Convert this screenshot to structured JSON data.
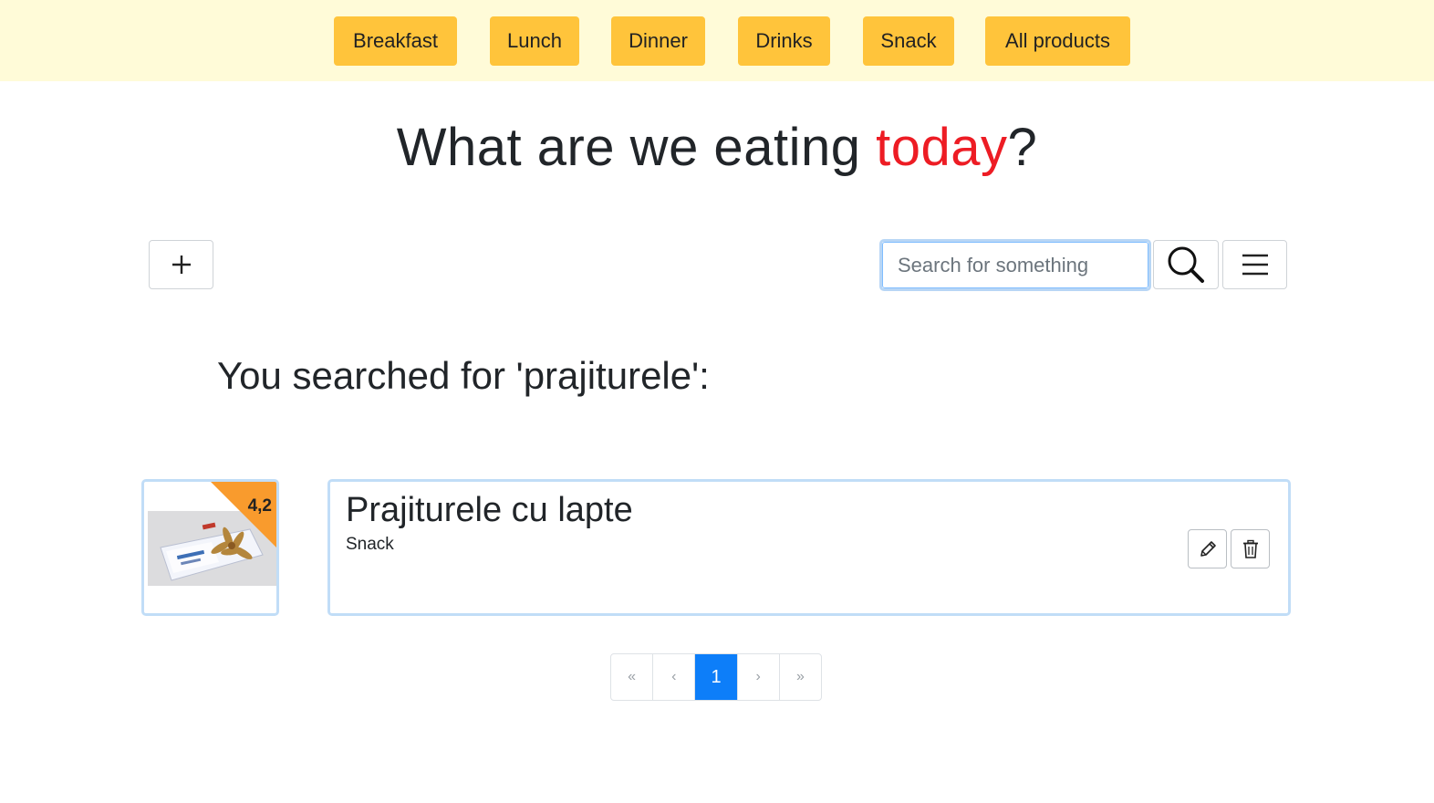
{
  "nav": {
    "items": [
      {
        "label": "Breakfast"
      },
      {
        "label": "Lunch"
      },
      {
        "label": "Dinner"
      },
      {
        "label": "Drinks"
      },
      {
        "label": "Snack"
      },
      {
        "label": "All products"
      }
    ]
  },
  "headline": {
    "before": "What are we eating ",
    "accent": "today",
    "after": "?"
  },
  "toolbar": {
    "add_icon": "plus-icon",
    "search_placeholder": "Search for something",
    "search_value": "",
    "search_icon": "search-icon",
    "menu_icon": "hamburger-menu-icon"
  },
  "results": {
    "title": "You searched for 'prajiturele':",
    "items": [
      {
        "name": "Prajiturele cu lapte",
        "category": "Snack",
        "rating": "4,2",
        "edit_icon": "pencil-icon",
        "delete_icon": "trash-icon"
      }
    ]
  },
  "pagination": {
    "first": "«",
    "prev": "‹",
    "current": "1",
    "next": "›",
    "last": "»"
  },
  "colors": {
    "nav_bg": "#fffbd8",
    "nav_button": "#ffc43b",
    "accent": "#ed1c24",
    "rating_badge": "#f99b2d",
    "card_border": "#c1ddf7",
    "pager_active": "#0d7ef9"
  }
}
